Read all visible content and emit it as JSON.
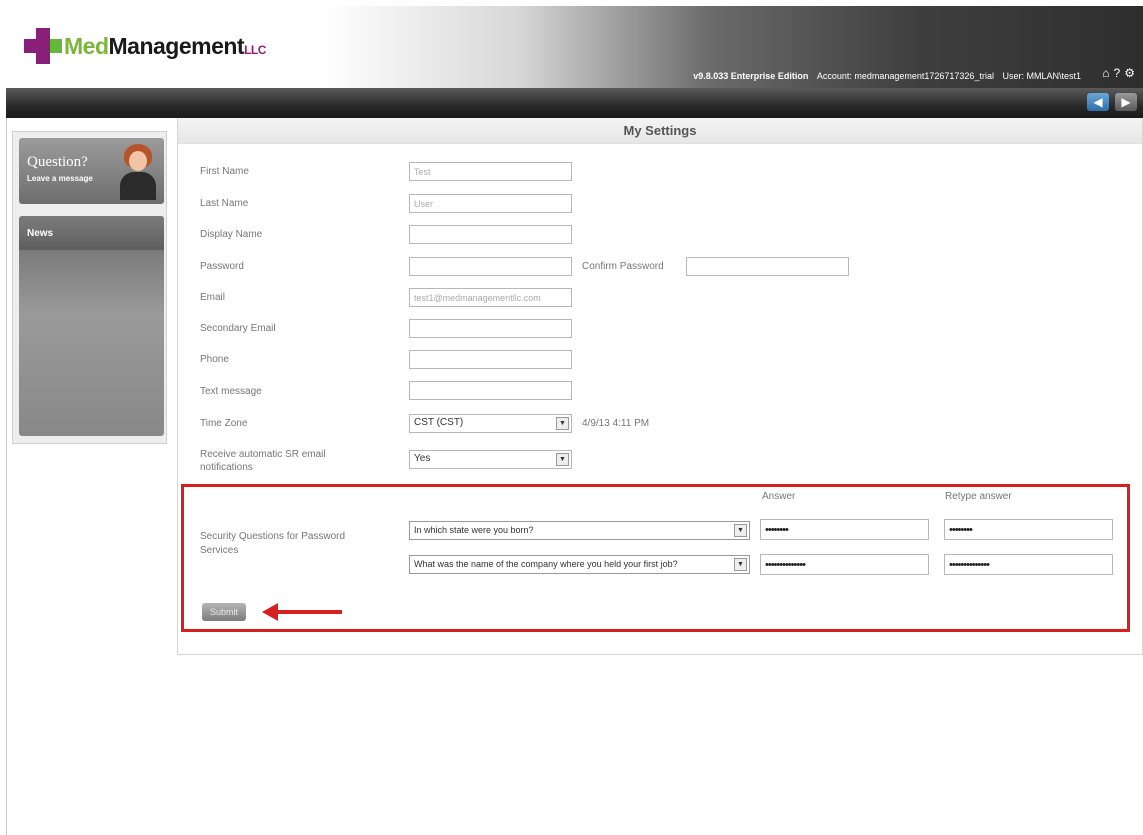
{
  "header": {
    "logo": {
      "prefix": "Med",
      "name": "Management",
      "suffix": "LLC"
    },
    "version": "v9.8.033 Enterprise Edition",
    "account": "Account: medmanagement1726717326_trial",
    "user": "User: MMLAN\\test1",
    "icons": [
      "home-icon",
      "help-icon",
      "settings-icon"
    ]
  },
  "nav": {
    "back_icon": "back-arrow-icon",
    "forward_icon": "forward-arrow-icon"
  },
  "sidebar": {
    "question_title": "Question?",
    "question_sub": "Leave a message",
    "news_title": "News"
  },
  "page": {
    "title": "My Settings",
    "fields": {
      "first_name": {
        "label": "First Name",
        "value": "Test"
      },
      "last_name": {
        "label": "Last Name",
        "value": "User"
      },
      "display_name": {
        "label": "Display Name",
        "value": ""
      },
      "password": {
        "label": "Password",
        "value": ""
      },
      "confirm_password": {
        "label": "Confirm Password",
        "value": ""
      },
      "email": {
        "label": "Email",
        "value": "test1@medmanagementllc.com"
      },
      "secondary_email": {
        "label": "Secondary Email",
        "value": ""
      },
      "phone": {
        "label": "Phone",
        "value": ""
      },
      "text_message": {
        "label": "Text message",
        "value": ""
      },
      "time_zone": {
        "label": "Time Zone",
        "value": "CST (CST)",
        "current_time": "4/9/13 4:11 PM"
      },
      "notifications": {
        "label": "Receive automatic SR email notifications",
        "value": "Yes"
      }
    },
    "security": {
      "label": "Security Questions for Password Services",
      "answer_header": "Answer",
      "retype_header": "Retype answer",
      "questions": [
        {
          "question": "In which state were you born?",
          "answer": "••••••••",
          "retype": "••••••••"
        },
        {
          "question": "What was the name of the company where you held your first job?",
          "answer": "••••••••••••••",
          "retype": "••••••••••••••"
        }
      ]
    },
    "submit_label": "Submit"
  },
  "colors": {
    "highlight": "#d81e1e",
    "brand_purple": "#8a1f7a",
    "brand_green": "#7bb63a"
  }
}
